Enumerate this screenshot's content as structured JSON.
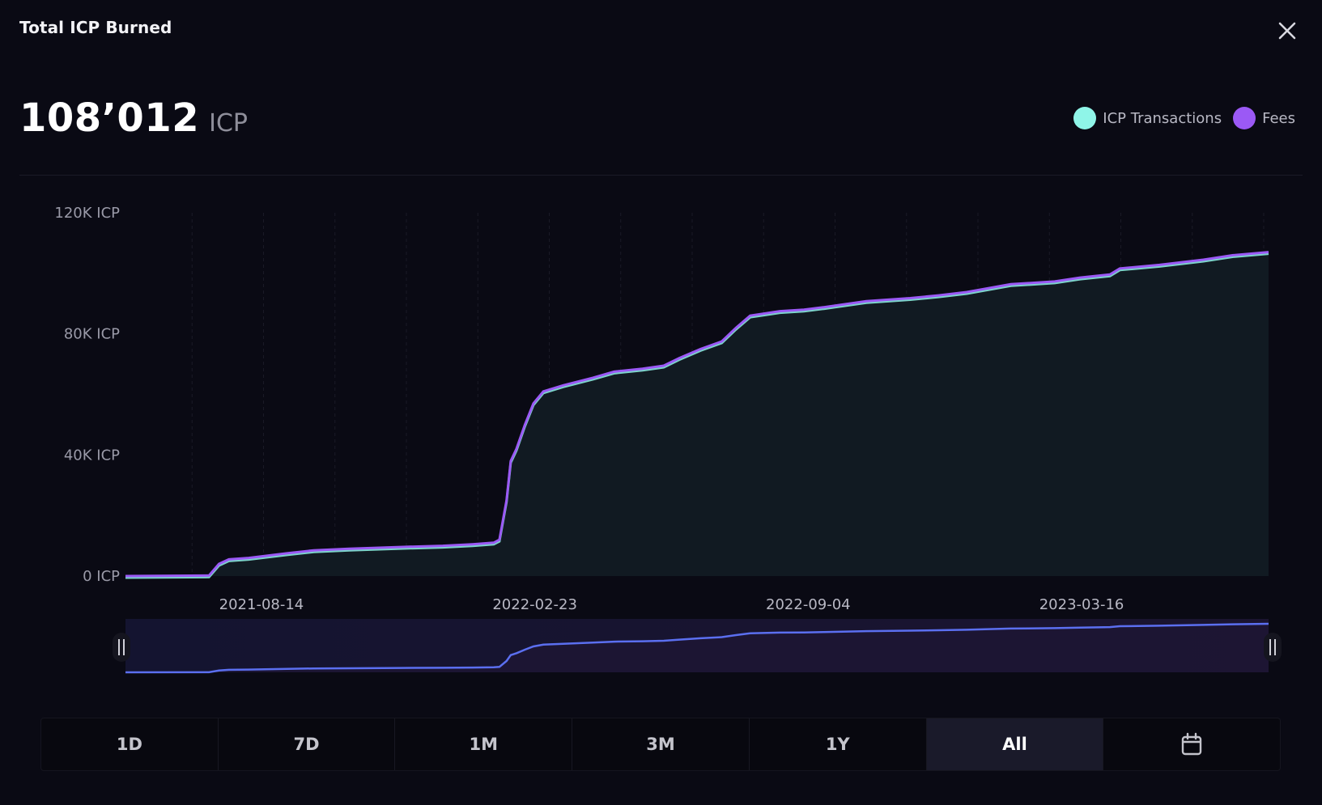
{
  "header": {
    "title": "Total ICP Burned",
    "close_icon": "close-icon"
  },
  "summary": {
    "value": "108’012",
    "unit": "ICP"
  },
  "legend": [
    {
      "label": "ICP Transactions",
      "color": "#8ff5e8"
    },
    {
      "label": "Fees",
      "color": "#9b59f5"
    }
  ],
  "ranges": {
    "items": [
      "1D",
      "7D",
      "1M",
      "3M",
      "1Y",
      "All"
    ],
    "active": "All",
    "calendar_icon": "calendar-icon"
  },
  "chart_data": {
    "type": "area",
    "x_axis": {
      "type": "date",
      "range": [
        "2021-05-10",
        "2023-07-26"
      ],
      "tick_labels": [
        "2021-08-14",
        "2022-02-23",
        "2022-09-04",
        "2023-03-16"
      ]
    },
    "y_axis": {
      "range": [
        0,
        120000
      ],
      "tick_labels": [
        "0 ICP",
        "40K ICP",
        "80K ICP",
        "120K ICP"
      ],
      "tick_values": [
        0,
        40000,
        80000,
        120000
      ]
    },
    "grid": "vertical-dashed",
    "series": [
      {
        "name": "Fees",
        "color": "#9b59f5",
        "x": [
          "2021-05-10",
          "2021-07-08",
          "2021-07-15",
          "2021-07-22",
          "2021-08-05",
          "2021-09-01",
          "2021-09-20",
          "2021-10-15",
          "2021-11-20",
          "2021-12-20",
          "2022-01-10",
          "2022-01-25",
          "2022-01-29",
          "2022-02-03",
          "2022-02-06",
          "2022-02-10",
          "2022-02-16",
          "2022-02-22",
          "2022-03-01",
          "2022-03-15",
          "2022-04-05",
          "2022-04-20",
          "2022-05-10",
          "2022-05-25",
          "2022-06-05",
          "2022-06-20",
          "2022-07-05",
          "2022-07-15",
          "2022-07-25",
          "2022-08-15",
          "2022-09-01",
          "2022-09-15",
          "2022-10-15",
          "2022-11-15",
          "2022-12-05",
          "2022-12-25",
          "2023-01-25",
          "2023-02-25",
          "2023-03-15",
          "2023-04-05",
          "2023-04-12",
          "2023-05-10",
          "2023-06-10",
          "2023-07-01",
          "2023-07-26"
        ],
        "y": [
          0,
          200,
          4000,
          5500,
          6000,
          7500,
          8500,
          9000,
          9600,
          10000,
          10500,
          11000,
          12000,
          25000,
          38000,
          42000,
          50000,
          57000,
          61000,
          63000,
          65500,
          67500,
          68500,
          69500,
          72000,
          75000,
          77500,
          82000,
          86000,
          87500,
          88000,
          88800,
          90800,
          91800,
          92700,
          93800,
          96400,
          97300,
          98600,
          99600,
          101600,
          102800,
          104500,
          106000,
          107000
        ]
      }
    ]
  }
}
